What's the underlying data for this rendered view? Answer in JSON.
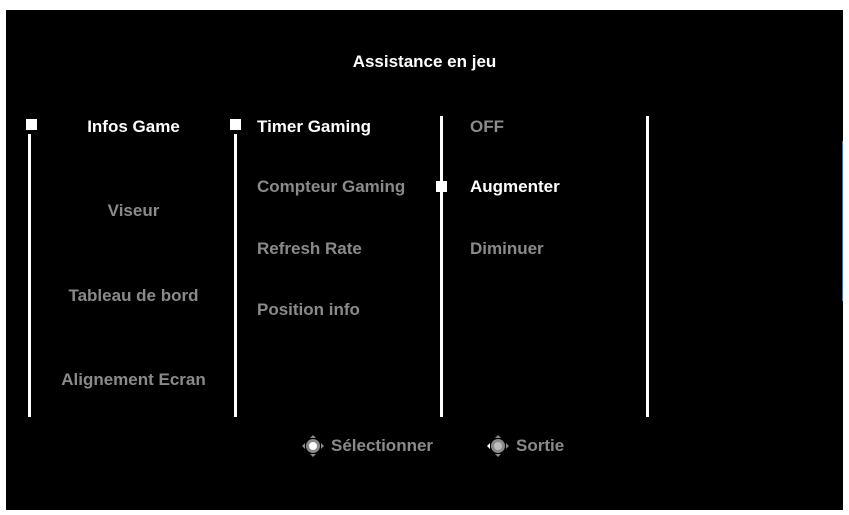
{
  "title": "Assistance en jeu",
  "menu_level1": {
    "items": [
      {
        "label": "Infos Game",
        "active": true
      },
      {
        "label": "Viseur",
        "active": false
      },
      {
        "label": "Tableau de bord",
        "active": false
      },
      {
        "label": "Alignement Ecran",
        "active": false
      }
    ]
  },
  "menu_level2": {
    "items": [
      {
        "label": "Timer Gaming",
        "active": true
      },
      {
        "label": "Compteur Gaming",
        "active": false
      },
      {
        "label": "Refresh Rate",
        "active": false
      },
      {
        "label": "Position info",
        "active": false
      }
    ]
  },
  "menu_level3": {
    "items": [
      {
        "label": "OFF",
        "active": false
      },
      {
        "label": "Augmenter",
        "active": true
      },
      {
        "label": "Diminuer",
        "active": false
      }
    ]
  },
  "footer": {
    "select_label": "Sélectionner",
    "exit_label": "Sortie",
    "select_icon": "joystick-icon",
    "exit_icon": "joystick-icon"
  },
  "colors": {
    "background": "#000000",
    "active_text": "#ffffff",
    "inactive_text": "#8a8a8a",
    "scrollbar": "#1f7ac4"
  }
}
